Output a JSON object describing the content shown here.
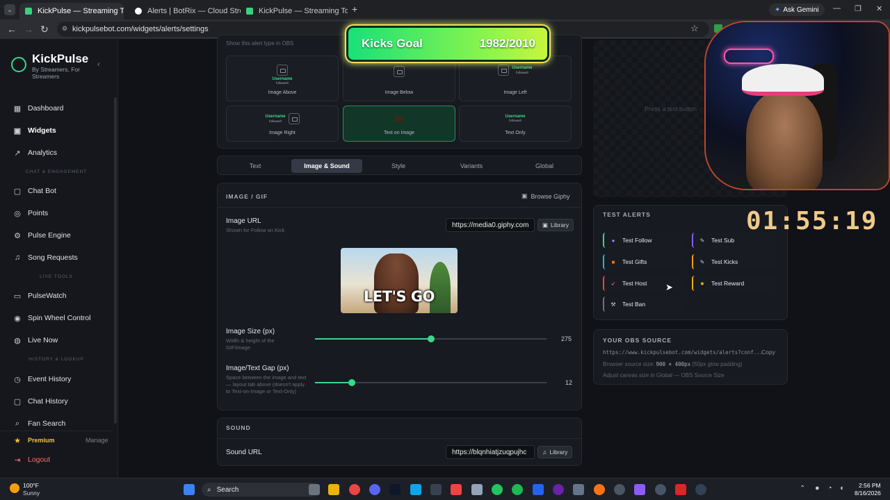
{
  "browser": {
    "tabs": [
      {
        "title": "KickPulse — Streaming Tools fo",
        "active": true
      },
      {
        "title": "Alerts | BotRix — Cloud Stream",
        "active": false
      },
      {
        "title": "KickPulse — Streaming Tools fo",
        "active": false
      }
    ],
    "url": "kickpulsebot.com/widgets/alerts/settings",
    "gemini": "Ask Gemini"
  },
  "sidebar": {
    "brand": "KickPulse",
    "tagline": "By Streamers, For Streamers",
    "items": [
      {
        "label": "Dashboard",
        "icon": "grid-icon"
      },
      {
        "label": "Widgets",
        "icon": "widgets-icon"
      },
      {
        "label": "Analytics",
        "icon": "trend-icon"
      },
      {
        "label": "Chat Bot",
        "icon": "bot-icon"
      },
      {
        "label": "Points",
        "icon": "points-icon"
      },
      {
        "label": "Pulse Engine",
        "icon": "engine-icon"
      },
      {
        "label": "Song Requests",
        "icon": "music-icon"
      },
      {
        "label": "PulseWatch",
        "icon": "monitor-icon"
      },
      {
        "label": "Spin Wheel Control",
        "icon": "wheel-icon"
      },
      {
        "label": "Live Now",
        "icon": "live-icon"
      },
      {
        "label": "Event History",
        "icon": "history-icon"
      },
      {
        "label": "Chat History",
        "icon": "chat-icon"
      },
      {
        "label": "Fan Search",
        "icon": "search-icon"
      }
    ],
    "sections": {
      "chat": "CHAT & ENGAGEMENT",
      "live": "LIVE TOOLS",
      "history": "HISTORY & LOOKUP"
    },
    "premium": "Premium",
    "manage": "Manage",
    "logout": "Logout"
  },
  "layouts": {
    "hint": "Show this alert type in OBS",
    "options": [
      "Image Above",
      "Image Below",
      "Image Left",
      "Image Right",
      "Text on Image",
      "Text Only"
    ],
    "selected": "Text on Image",
    "username": "Username",
    "followed": "followed!"
  },
  "tabs": [
    "Text",
    "Image & Sound",
    "Style",
    "Variants",
    "Global"
  ],
  "active_tab": "Image & Sound",
  "image_section": {
    "title": "IMAGE / GIF",
    "browse": "Browse Giphy",
    "url_label": "Image URL",
    "url_sub": "Shown for Follow on Kick",
    "url_value": "https://media0.giphy.com",
    "library": "Library",
    "preview_caption": "LET'S GO",
    "size_label": "Image Size (px)",
    "size_sub": "Width & height of the GIF/image",
    "size_value": "275",
    "size_fraction": 0.5,
    "gap_label": "Image/Text Gap (px)",
    "gap_sub": "Space between the image and text — layout tab above (doesn't apply to Text-on-Image or Text-Only)",
    "gap_value": "12",
    "gap_fraction": 0.16
  },
  "sound_section": {
    "title": "SOUND",
    "url_label": "Sound URL",
    "url_value": "https://blqnhiatjzuqpujhc",
    "library": "Library"
  },
  "preview": {
    "hint": "Press a test button"
  },
  "test_alerts": {
    "title": "TEST ALERTS",
    "buttons": [
      {
        "label": "Test Follow",
        "color": "#39d98a"
      },
      {
        "label": "Test Sub",
        "color": "#8b5cf6"
      },
      {
        "label": "Test Gifts",
        "color": "#22b8cf"
      },
      {
        "label": "Test Kicks",
        "color": "#f59e0b"
      },
      {
        "label": "Test Host",
        "color": "#ef4444"
      },
      {
        "label": "Test Reward",
        "color": "#eab308"
      },
      {
        "label": "Test Ban",
        "color": "#6b7280"
      }
    ]
  },
  "obs": {
    "title": "YOUR OBS SOURCE",
    "url": "https://www.kickpulsebot.com/widgets/alerts?conf...",
    "copy": "Copy",
    "size_prefix": "Browser source size:",
    "size_value": "900 × 400px",
    "size_note": "(50px glow padding)",
    "hint": "Adjust canvas size in Global — OBS Source Size"
  },
  "overlay": {
    "goal_label": "Kicks Goal",
    "goal_value": "1982/2010",
    "goal_progress": 0.986,
    "timer": "01:55:19"
  },
  "taskbar": {
    "weather_temp": "100°F",
    "weather_desc": "Sunny",
    "search": "Search",
    "time": "2:56 PM",
    "date": "8/16/2026"
  },
  "colors": {
    "accent": "#39d98a",
    "bg": "#101217"
  }
}
